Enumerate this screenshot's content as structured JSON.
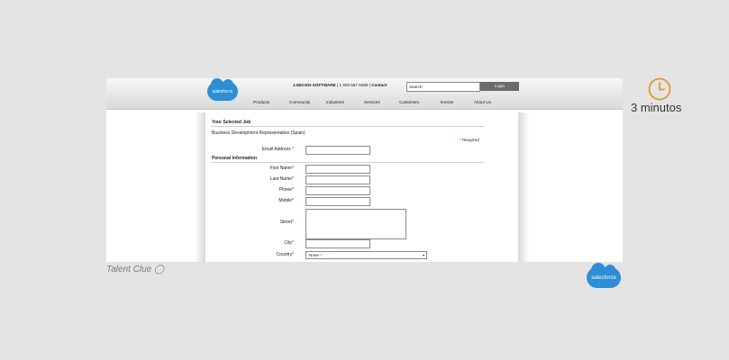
{
  "header": {
    "logo_text": "salesforce",
    "phone_primary": "1-800-NO-SOFTWARE",
    "phone_secondary": "1 800 667 6389",
    "contact_label": "Contact",
    "search_placeholder": "Search",
    "login_label": "Login",
    "nav": [
      "Products",
      "Community",
      "Industries",
      "Services",
      "Customers",
      "Events",
      "About Us"
    ]
  },
  "form": {
    "selected_job_title": "Your Selected Job",
    "job_name": "Business Development Representative (Spain)",
    "required_star": "*",
    "required_label": "Required",
    "email_label": "Email Address",
    "personal_info_title": "Personal Information",
    "first_name_label": "First Name",
    "last_name_label": "Last Name",
    "phone_label": "Phone",
    "mobile_label": "Mobile",
    "street_label": "Street",
    "city_label": "City",
    "country_label": "Country",
    "country_value": "None"
  },
  "overlay": {
    "duration_text": "3 minutos",
    "talent_clue": "Talent Clue",
    "salesforce_logo": "salesforce"
  },
  "colors": {
    "accent_orange": "#e09a2c",
    "salesforce_blue": "#2b8ed6",
    "required_red": "#c00000"
  }
}
